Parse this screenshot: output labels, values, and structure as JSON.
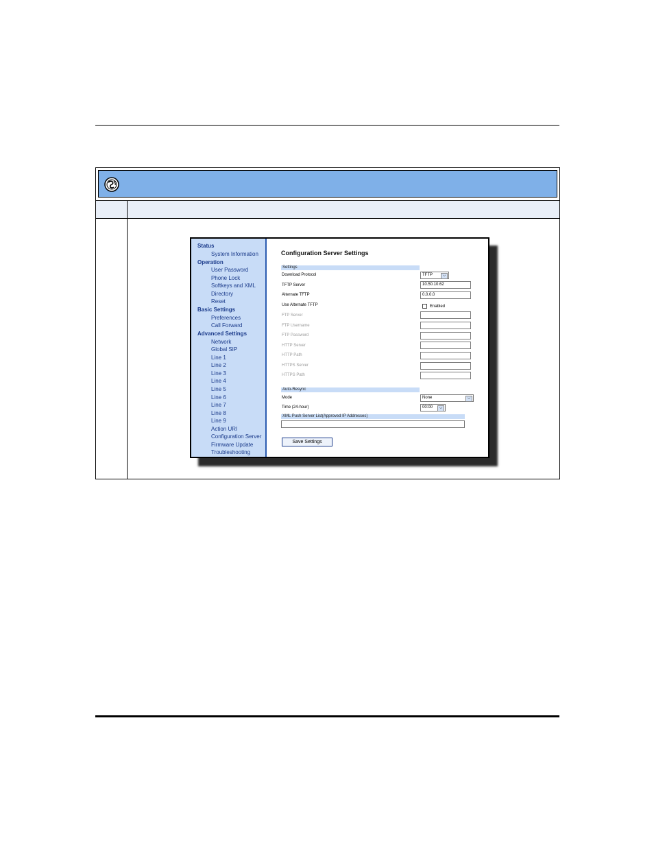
{
  "nav": {
    "sections": [
      {
        "label": "Status",
        "items": [
          "System Information"
        ]
      },
      {
        "label": "Operation",
        "items": [
          "User Password",
          "Phone Lock",
          "Softkeys and XML",
          "Directory",
          "Reset"
        ]
      },
      {
        "label": "Basic Settings",
        "items": [
          "Preferences",
          "Call Forward"
        ]
      },
      {
        "label": "Advanced Settings",
        "items": [
          "Network",
          "Global SIP",
          "Line 1",
          "Line 2",
          "Line 3",
          "Line 4",
          "Line 5",
          "Line 6",
          "Line 7",
          "Line 8",
          "Line 9",
          "Action URI",
          "Configuration Server",
          "Firmware Update",
          "Troubleshooting"
        ]
      }
    ]
  },
  "page": {
    "title": "Configuration Server Settings",
    "settings_header": "Settings",
    "download_protocol_label": "Download Protocol",
    "download_protocol_value": "TFTP",
    "tftp_server_label": "TFTP Server",
    "tftp_server_value": "10.50.10.62",
    "alternate_tftp_label": "Alternate TFTP",
    "alternate_tftp_value": "0.0.0.0",
    "use_alternate_tftp_label": "Use Alternate TFTP",
    "enabled_label": "Enabled",
    "ftp_server_label": "FTP Server",
    "ftp_username_label": "FTP Username",
    "ftp_password_label": "FTP Password",
    "http_server_label": "HTTP Server",
    "http_path_label": "HTTP Path",
    "https_server_label": "HTTPS Server",
    "https_path_label": "HTTPS Path",
    "auto_resync_header": "Auto-Resync",
    "mode_label": "Mode",
    "mode_value": "None",
    "time_label": "Time (24-hour)",
    "time_value": "00:00",
    "xml_push_header": "XML Push Server List(Approved IP Addresses)",
    "save_button": "Save Settings"
  },
  "icons": {
    "banner": "globe-icon",
    "dropdown": "chevron-down-icon"
  },
  "colors": {
    "banner": "#7fb0e8",
    "nav_bg": "#c8dcf7",
    "nav_text": "#1a3a8a"
  }
}
